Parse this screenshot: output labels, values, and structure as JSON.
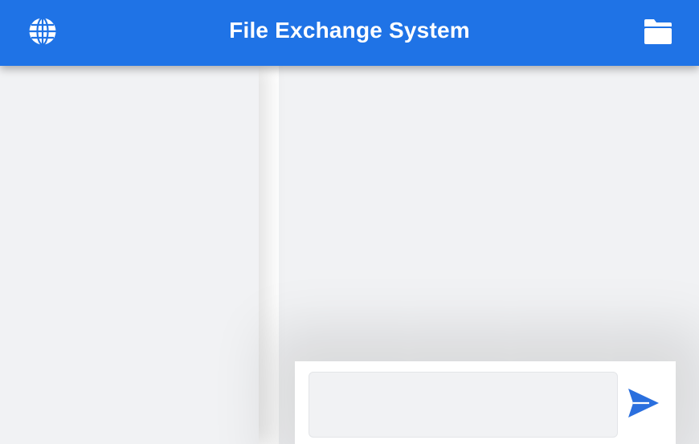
{
  "header": {
    "title": "File Exchange System",
    "globe_icon": "globe-icon",
    "folder_icon": "folder-icon"
  },
  "composer": {
    "input_value": "",
    "input_placeholder": "",
    "send_icon": "send-icon"
  },
  "colors": {
    "header_bg": "#1f73e6",
    "page_bg": "#f1f2f4",
    "accent": "#1f73e6",
    "send_icon": "#2a6fde"
  }
}
